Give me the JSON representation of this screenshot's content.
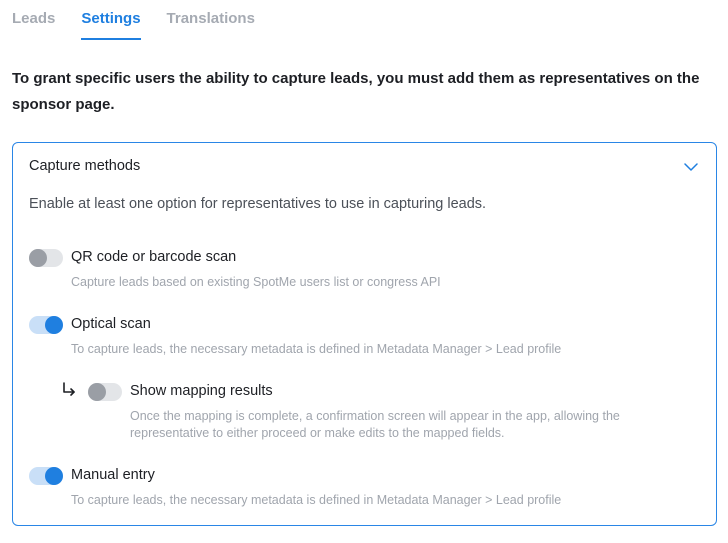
{
  "tabs": [
    {
      "label": "Leads",
      "active": false
    },
    {
      "label": "Settings",
      "active": true
    },
    {
      "label": "Translations",
      "active": false
    }
  ],
  "intro": "To grant specific users the ability to capture leads, you must add them as representatives on the sponsor page.",
  "panel": {
    "title": "Capture methods",
    "description": "Enable at least one option for representatives to use in capturing leads.",
    "options": [
      {
        "label": "QR code or barcode scan",
        "help": "Capture leads based on existing SpotMe users list or congress API",
        "enabled": false
      },
      {
        "label": "Optical scan",
        "help": "To capture leads, the necessary metadata is defined in Metadata Manager > Lead profile",
        "enabled": true
      },
      {
        "label": "Show mapping results",
        "help": "Once the mapping is complete, a confirmation screen will appear in the app, allowing the representative to either proceed or make edits to the mapped fields.",
        "enabled": false
      },
      {
        "label": "Manual entry",
        "help": "To capture leads, the necessary metadata is defined in Metadata Manager > Lead profile",
        "enabled": true
      }
    ]
  },
  "colors": {
    "accent": "#1f7fe0",
    "border": "#2a86e6"
  }
}
